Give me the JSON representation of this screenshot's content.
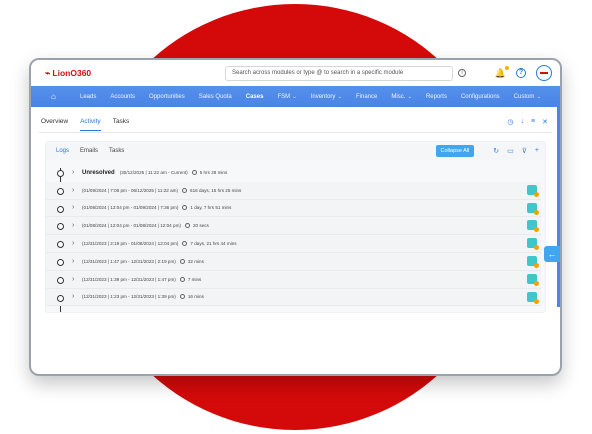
{
  "app": {
    "logo_text": "LionO360"
  },
  "search": {
    "placeholder": "Search across modules or type @ to search in a specific module"
  },
  "nav": {
    "items": [
      {
        "label": "Leads"
      },
      {
        "label": "Accounts"
      },
      {
        "label": "Opportunities"
      },
      {
        "label": "Sales Quota"
      },
      {
        "label": "Cases",
        "active": true
      },
      {
        "label": "FSM",
        "dropdown": true
      },
      {
        "label": "Inventory",
        "dropdown": true
      },
      {
        "label": "Finance"
      },
      {
        "label": "Misc.",
        "dropdown": true
      },
      {
        "label": "Reports"
      },
      {
        "label": "Configurations"
      },
      {
        "label": "Custom",
        "dropdown": true
      }
    ]
  },
  "subtabs": [
    {
      "label": "Overview"
    },
    {
      "label": "Activity",
      "active": true
    },
    {
      "label": "Tasks"
    }
  ],
  "inner_tabs": [
    {
      "label": "Logs",
      "active": true
    },
    {
      "label": "Emails"
    },
    {
      "label": "Tasks"
    }
  ],
  "collapse_all_label": "Collapse All",
  "timeline": [
    {
      "title": "Unresolved",
      "range": "(30/12/2025 | 11:22 am - Current)",
      "duration": "5 hrs 28 mins",
      "first": true
    },
    {
      "range": "(01/09/2024 | 7:08 pm - 06/12/2025 | 11:22 am)",
      "duration": "616 days, 15 hrs 25 mins"
    },
    {
      "range": "(01/08/2024 | 12:04 pm - 01/09/2024 | 7:36 pm)",
      "duration": "1 day, 7 hrs 51 mins"
    },
    {
      "range": "(01/08/2024 | 12:04 pm - 01/08/2024 | 12:04 pm)",
      "duration": "20 secs"
    },
    {
      "range": "(12/31/2023 | 2:19 pm - 01/08/2024 | 12:04 pm)",
      "duration": "7 days, 21 hrs 44 mins"
    },
    {
      "range": "(12/31/2023 | 1:47 pm - 12/31/2023 | 2:19 pm)",
      "duration": "32 mins"
    },
    {
      "range": "(12/31/2023 | 1:39 pm - 12/31/2023 | 1:47 pm)",
      "duration": "7 mins"
    },
    {
      "range": "(12/31/2023 | 1:23 pm - 12/31/2023 | 1:39 pm)",
      "duration": "16 mins"
    }
  ],
  "colors": {
    "brand_red": "#d01010",
    "nav_blue": "#4a86e8",
    "accent_blue": "#2a7ad9"
  }
}
